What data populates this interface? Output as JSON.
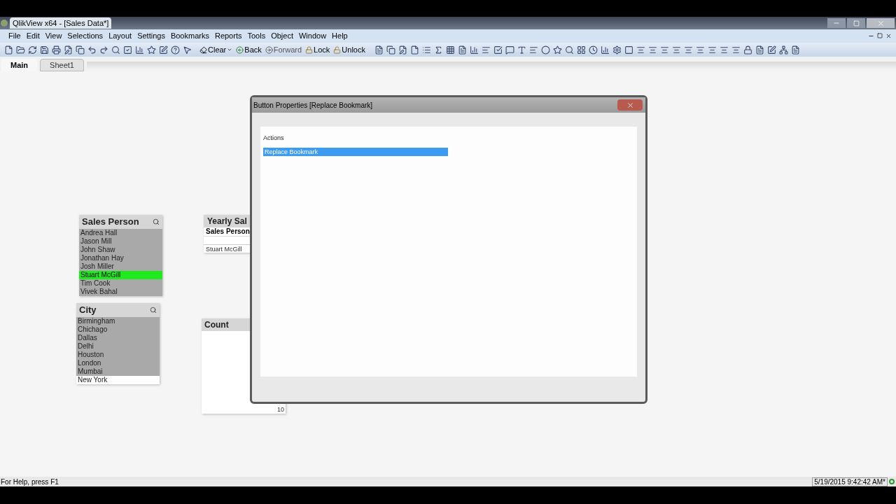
{
  "window": {
    "title": "QlikView x64 - [Sales Data*]"
  },
  "menu": [
    "File",
    "Edit",
    "View",
    "Selections",
    "Layout",
    "Settings",
    "Bookmarks",
    "Reports",
    "Tools",
    "Object",
    "Window",
    "Help"
  ],
  "toolbar": {
    "clear": "Clear",
    "back": "Back",
    "forward": "Forward",
    "lock": "Lock",
    "unlock": "Unlock"
  },
  "tabs": [
    {
      "label": "Main",
      "selected": true
    },
    {
      "label": "Sheet1",
      "selected": false
    }
  ],
  "sales_person": {
    "title": "Sales Person",
    "items": [
      {
        "label": "Andrea Hall",
        "selected": false,
        "excluded": true
      },
      {
        "label": "Jason Mill",
        "selected": false,
        "excluded": true
      },
      {
        "label": "John Shaw",
        "selected": false,
        "excluded": true
      },
      {
        "label": "Jonathan Hay",
        "selected": false,
        "excluded": true
      },
      {
        "label": "Josh Miller",
        "selected": false,
        "excluded": true
      },
      {
        "label": "Stuart McGill",
        "selected": true,
        "excluded": false
      },
      {
        "label": "Tim Cook",
        "selected": false,
        "excluded": true
      },
      {
        "label": "Vivek Bahal",
        "selected": false,
        "excluded": true
      }
    ]
  },
  "city": {
    "title": "City",
    "items": [
      {
        "label": "Birmingham",
        "selected": false,
        "excluded": true
      },
      {
        "label": "Chichago",
        "selected": false,
        "excluded": true
      },
      {
        "label": "Dallas",
        "selected": false,
        "excluded": true
      },
      {
        "label": "Delhi",
        "selected": false,
        "excluded": true
      },
      {
        "label": "Houston",
        "selected": false,
        "excluded": true
      },
      {
        "label": "London",
        "selected": false,
        "excluded": true
      },
      {
        "label": "Mumbai",
        "selected": false,
        "excluded": true
      },
      {
        "label": "New York",
        "selected": false,
        "excluded": false
      }
    ]
  },
  "yearly_sales": {
    "title": "Yearly Sal",
    "column": "Sales Person",
    "row": "Stuart McGill"
  },
  "count": {
    "title": "Count",
    "visible_value": "10"
  },
  "dialog": {
    "title": "Button Properties [Replace Bookmark]",
    "actions_label": "Actions",
    "actions": [
      {
        "label": "Replace Bookmark",
        "selected": true
      }
    ]
  },
  "status_bar": {
    "help": "For Help, press F1",
    "timestamp": "5/19/2015 9:42:42 AM*"
  }
}
